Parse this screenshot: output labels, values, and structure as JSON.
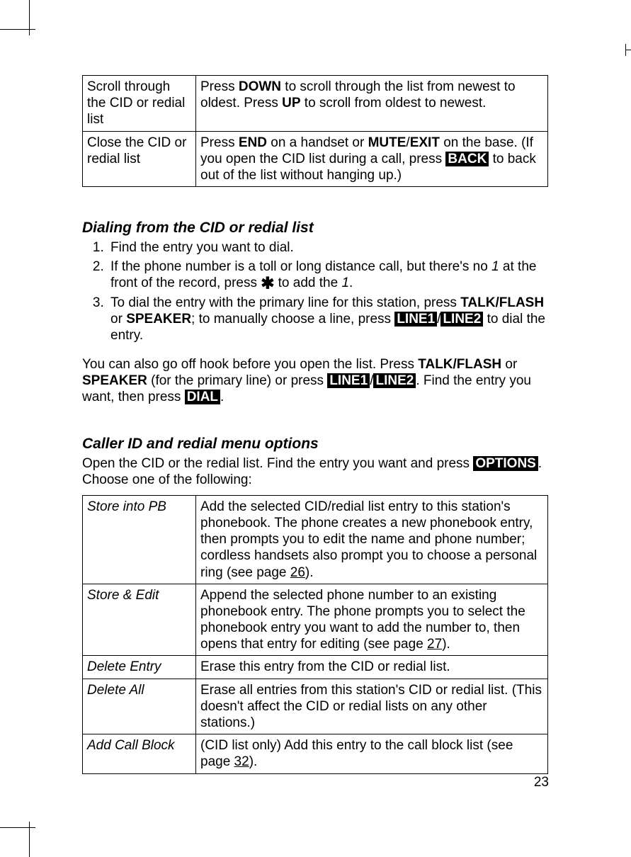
{
  "table1": {
    "r1": {
      "action": "Scroll through the CID or redial list",
      "desc_a": "Press ",
      "desc_b": "DOWN",
      "desc_c": " to scroll through the list from newest to oldest. Press ",
      "desc_d": "UP",
      "desc_e": " to scroll from oldest to newest."
    },
    "r2": {
      "action": "Close the CID or redial list",
      "desc_a": "Press ",
      "desc_b": "END",
      "desc_c": " on a handset or ",
      "desc_d": "MUTE",
      "desc_e": "/",
      "desc_f": "EXIT",
      "desc_g": " on the base. (If you open the CID list during a call, press ",
      "desc_h": "BACK",
      "desc_i": " to back out of the list without hanging up.)"
    }
  },
  "section1": {
    "heading": "Dialing from the CID or redial list",
    "step1": "Find the entry you want to dial.",
    "step2_a": "If the phone number is a toll or long distance call, but there's no ",
    "step2_b": "1",
    "step2_c": " at the front of the record, press ",
    "step2_d": "✱",
    "step2_e": " to add the ",
    "step2_f": "1",
    "step2_g": ".",
    "step3_a": "To dial the entry with the primary line for this station, press ",
    "step3_b": "TALK/FLASH",
    "step3_c": " or ",
    "step3_d": "SPEAKER",
    "step3_e": "; to manually choose a line, press ",
    "step3_f": "LINE1",
    "step3_g": "/",
    "step3_h": "LINE2",
    "step3_i": " to dial the entry.",
    "para_a": "You can also go off hook before you open the list. Press ",
    "para_b": "TALK/FLASH",
    "para_c": " or ",
    "para_d": "SPEAKER",
    "para_e": " (for the primary line) or press ",
    "para_f": "LINE1",
    "para_g": "/",
    "para_h": "LINE2",
    "para_i": ". Find the entry you want, then press ",
    "para_j": "DIAL",
    "para_k": "."
  },
  "section2": {
    "heading": "Caller ID and redial menu options",
    "intro_a": "Open the CID or the redial list. Find the entry you want and press ",
    "intro_b": "OPTIONS",
    "intro_c": ". Choose one of the following:"
  },
  "table2": {
    "r1": {
      "name": "Store into PB",
      "desc_a": "Add the selected CID/redial list entry to this station's phonebook. The phone creates a new phonebook entry, then prompts you to edit the name and phone number; cordless handsets also prompt you to choose a personal ring (see page ",
      "desc_b": "26",
      "desc_c": ")."
    },
    "r2": {
      "name": "Store & Edit",
      "desc_a": "Append the selected phone number to an existing phonebook entry. The phone prompts you to select the phonebook entry you want to add the number to, then opens that entry for editing (see page ",
      "desc_b": "27",
      "desc_c": ")."
    },
    "r3": {
      "name": "Delete Entry",
      "desc": "Erase this entry from the CID or redial list."
    },
    "r4": {
      "name": "Delete All",
      "desc": "Erase all entries from this station's CID or redial list. (This doesn't affect the CID or redial lists on any other stations.)"
    },
    "r5": {
      "name": "Add Call Block",
      "desc_a": "(CID list only) Add this entry to the call block list (see page ",
      "desc_b": "32",
      "desc_c": ")."
    }
  },
  "page_number": "23"
}
